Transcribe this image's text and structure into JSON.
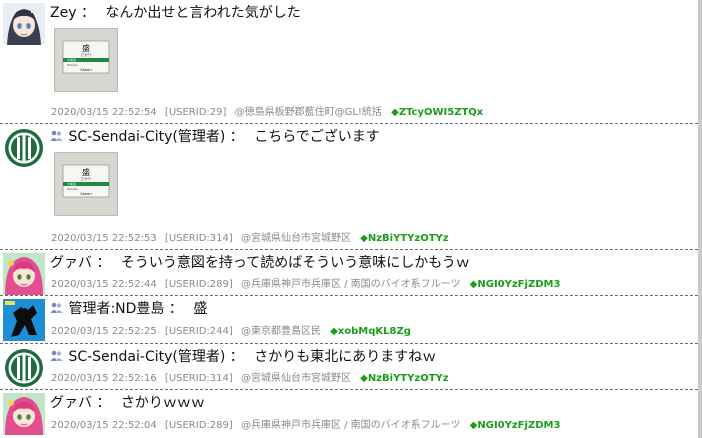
{
  "colors": {
    "trip": "#1a9e1a",
    "meta": "#8a8a8a",
    "divider": "#6b6b6b"
  },
  "posts": [
    {
      "avatar_icon": "anime-girl-avatar-icon",
      "name": "Zey",
      "sep": "：",
      "message": "なんか出せと言われた気がした",
      "image": {
        "station": "盛",
        "reading": "さかり",
        "romaji": "Sakari",
        "prev": "大船渡",
        "prev_romaji": "Ofunato"
      },
      "date": "2020/03/15 22:52:54",
      "userid": "[USERID:29]",
      "location": "@徳島県板野郡藍住町@GL!統括",
      "trip": "◆ZTcyOWI5ZTQx"
    },
    {
      "avatar_icon": "sendai-city-emblem-icon",
      "admin": true,
      "name": "SC-Sendai-City(管理者)",
      "sep": "：",
      "message": "こちらでございます",
      "image": {
        "station": "盛",
        "reading": "さかり",
        "romaji": "Sakari",
        "prev": "大船渡",
        "prev_romaji": "Ofunato"
      },
      "date": "2020/03/15 22:52:53",
      "userid": "[USERID:314]",
      "location": "@宮城県仙台市宮城野区",
      "trip": "◆NzBiYTYzOTYz"
    },
    {
      "avatar_icon": "pink-hair-girl-avatar-icon",
      "name": "グァバ",
      "sep": "：",
      "message": "そういう意図を持って読めばそういう意味にしかもうｗ",
      "date": "2020/03/15 22:52:44",
      "userid": "[USERID:289]",
      "location": "@兵庫県神戸市兵庫区 / 南国のバイオ系フルーツ",
      "trip": "◆NGI0YzFjZDM3"
    },
    {
      "avatar_icon": "robot-silhouette-avatar-icon",
      "admin": true,
      "name": "管理者:ND豊島",
      "sep": "：",
      "message": "盛",
      "date": "2020/03/15 22:52:25",
      "userid": "[USERID:244]",
      "location": "@東京都豊島区民",
      "trip": "◆xobMqKL8Zg"
    },
    {
      "avatar_icon": "sendai-city-emblem-icon",
      "admin": true,
      "name": "SC-Sendai-City(管理者)",
      "sep": "：",
      "message": "さかりも東北にありますねｗ",
      "date": "2020/03/15 22:52:16",
      "userid": "[USERID:314]",
      "location": "@宮城県仙台市宮城野区",
      "trip": "◆NzBiYTYzOTYz"
    },
    {
      "avatar_icon": "pink-hair-girl-avatar-icon",
      "name": "グァバ",
      "sep": "：",
      "message": "さかりｗｗｗ",
      "date": "2020/03/15 22:52:04",
      "userid": "[USERID:289]",
      "location": "@兵庫県神戸市兵庫区 / 南国のバイオ系フルーツ",
      "trip": "◆NGI0YzFjZDM3"
    }
  ]
}
